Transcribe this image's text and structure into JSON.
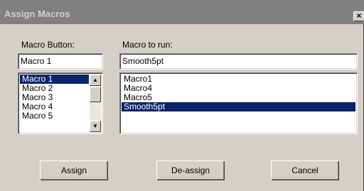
{
  "window": {
    "title": "Assign Macros",
    "close_label": "×"
  },
  "macro_button": {
    "label": "Macro Button:",
    "value": "Macro 1",
    "items": [
      "Macro 1",
      "Macro 2",
      "Macro 3",
      "Macro 4",
      "Macro 5"
    ],
    "selected": "Macro 1",
    "scroll_up_icon": "▲",
    "scroll_down_icon": "▼"
  },
  "macro_to_run": {
    "label": "Macro to run:",
    "value": "Smooth5pt",
    "items": [
      "Macro1",
      "Macro4",
      "Macro5",
      "Smooth5pt"
    ],
    "selected": "Smooth5pt"
  },
  "buttons": {
    "assign": "Assign",
    "deassign": "De-assign",
    "cancel": "Cancel"
  },
  "colors": {
    "face": "#d4d0c8",
    "titlebar": "#808080",
    "selection": "#0a246a"
  }
}
